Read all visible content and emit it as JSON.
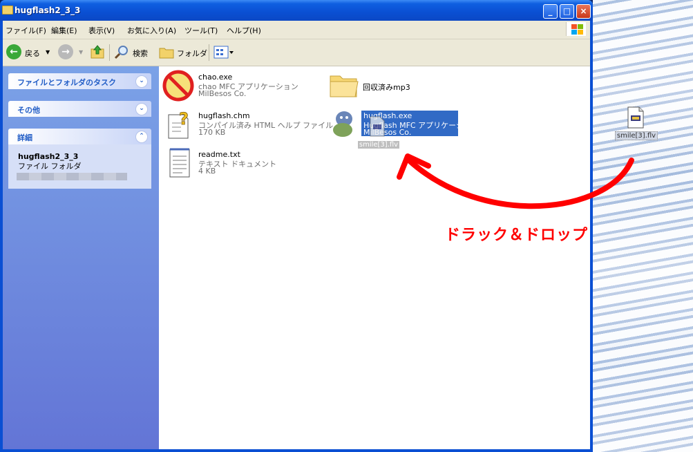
{
  "window": {
    "title": "hugflash2_3_3",
    "minimize": "_",
    "maximize": "□",
    "close": "×"
  },
  "menu": [
    "ファイル(F)",
    "編集(E)",
    "表示(V)",
    "お気に入り(A)",
    "ツール(T)",
    "ヘルプ(H)"
  ],
  "toolbar": {
    "back": "戻る",
    "search": "検索",
    "folders": "フォルダ"
  },
  "sidebar": {
    "tasks_title": "ファイルとフォルダのタスク",
    "other_title": "その他",
    "details_title": "詳細",
    "details_name": "hugflash2_3_3",
    "details_type": "ファイル フォルダ"
  },
  "files": [
    {
      "name": "chao.exe",
      "line2": "chao MFC アプリケーション",
      "line3": "MilBesos Co.",
      "icon": "no-entry-character-icon"
    },
    {
      "name": "回収済みmp3",
      "icon": "folder-icon"
    },
    {
      "name": "hugflash.chm",
      "line2": "コンパイル済み HTML ヘルプ ファイル",
      "line3": "170 KB",
      "icon": "help-file-icon"
    },
    {
      "name": "hugflash.exe",
      "line2": "Hugflash MFC アプリケーション",
      "line3": "MilBesos Co.",
      "icon": "dinosaur-character-icon"
    },
    {
      "name": "readme.txt",
      "line2": "テキスト ドキュメント",
      "line3": "4 KB",
      "icon": "text-document-icon"
    }
  ],
  "dragging": {
    "name": "smile[3].flv",
    "icon": "flv-file-icon"
  },
  "desktop_file": {
    "name": "smile[3].flv",
    "icon": "flv-file-icon"
  },
  "annotation": "ドラック＆ドロップ",
  "colors": {
    "annotation": "#ff0000",
    "selection": "#316ac5",
    "titlebar": "#0a4fd3"
  }
}
